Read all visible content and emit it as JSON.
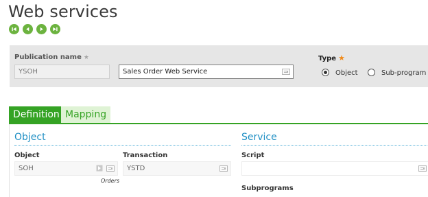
{
  "page": {
    "title": "Web services"
  },
  "navigation": {
    "buttons": [
      "first-record",
      "previous-record",
      "next-record",
      "last-record"
    ]
  },
  "header": {
    "publication_name_label": "Publication name",
    "publication_name_required_mark": "★",
    "publication_code": "YSOH",
    "publication_description": "Sales Order Web Service",
    "type_label": "Type",
    "type_required_mark": "★",
    "type_options": [
      {
        "label": "Object",
        "selected": true
      },
      {
        "label": "Sub-program",
        "selected": false
      }
    ]
  },
  "tabs": [
    {
      "label": "Definition",
      "active": true
    },
    {
      "label": "Mapping",
      "active": false
    }
  ],
  "object_section": {
    "title": "Object",
    "object_label": "Object",
    "object_value": "SOH",
    "object_description": "Orders",
    "transaction_label": "Transaction",
    "transaction_value": "YSTD"
  },
  "service_section": {
    "title": "Service",
    "script_label": "Script",
    "script_value": "",
    "subprograms_label": "Subprograms"
  },
  "colors": {
    "accent_green": "#35a324",
    "nav_green": "#6cb33f",
    "section_blue": "#1f8fc4",
    "required_orange": "#f08a1a"
  }
}
